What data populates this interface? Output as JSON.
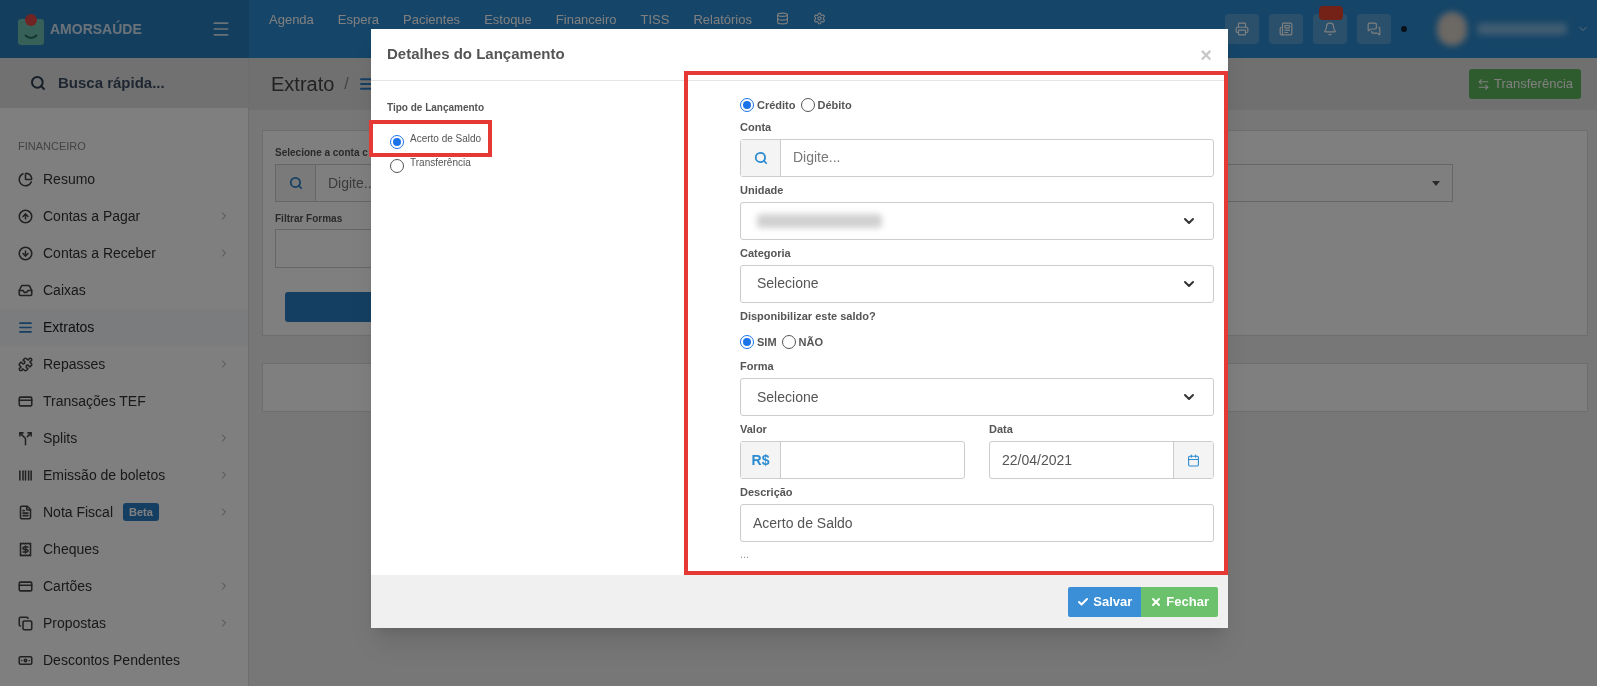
{
  "header": {
    "logo": "AMORSAÚDE",
    "nav": [
      "Agenda",
      "Espera",
      "Pacientes",
      "Estoque",
      "Financeiro",
      "TISS",
      "Relatórios"
    ]
  },
  "sidebar": {
    "search_placeholder": "Busca rápida...",
    "section": "FINANCEIRO",
    "items": [
      {
        "label": "Resumo",
        "expandable": false,
        "selected": false
      },
      {
        "label": "Contas a Pagar",
        "expandable": true,
        "selected": false
      },
      {
        "label": "Contas a Receber",
        "expandable": true,
        "selected": false
      },
      {
        "label": "Caixas",
        "expandable": false,
        "selected": false
      },
      {
        "label": "Extratos",
        "expandable": false,
        "selected": true
      },
      {
        "label": "Repasses",
        "expandable": true,
        "selected": false
      },
      {
        "label": "Transações TEF",
        "expandable": false,
        "selected": false
      },
      {
        "label": "Splits",
        "expandable": true,
        "selected": false
      },
      {
        "label": "Emissão de boletos",
        "expandable": true,
        "selected": false
      },
      {
        "label": "Nota Fiscal",
        "expandable": true,
        "selected": false,
        "badge": "Beta"
      },
      {
        "label": "Cheques",
        "expandable": false,
        "selected": false
      },
      {
        "label": "Cartões",
        "expandable": true,
        "selected": false
      },
      {
        "label": "Propostas",
        "expandable": true,
        "selected": false
      },
      {
        "label": "Descontos Pendentes",
        "expandable": false,
        "selected": false
      }
    ]
  },
  "page": {
    "title": "Extrato",
    "breadcrumb_separator": "/",
    "transfer_button": "Transferência",
    "account_label": "Selecione a conta c",
    "account_placeholder": "Digite..",
    "filter_label": "Filtrar Formas"
  },
  "modal": {
    "title": "Detalhes do Lançamento",
    "close": "×",
    "type_label": "Tipo de Lançamento",
    "types": [
      {
        "label": "Acerto de Saldo",
        "selected": true
      },
      {
        "label": "Transferência",
        "selected": false
      }
    ],
    "movement": [
      {
        "label": "Crédito",
        "selected": true
      },
      {
        "label": "Débito",
        "selected": false
      }
    ],
    "conta": {
      "label": "Conta",
      "placeholder": "Digite..."
    },
    "unidade": {
      "label": "Unidade"
    },
    "categoria": {
      "label": "Categoria",
      "value": "Selecione"
    },
    "disponibilizar": {
      "label": "Disponibilizar este saldo?",
      "options": [
        {
          "label": "SIM",
          "selected": true
        },
        {
          "label": "NÃO",
          "selected": false
        }
      ]
    },
    "forma": {
      "label": "Forma",
      "value": "Selecione"
    },
    "valor": {
      "label": "Valor",
      "prefix": "R$"
    },
    "data": {
      "label": "Data",
      "value": "22/04/2021"
    },
    "descricao": {
      "label": "Descrição",
      "value": "Acerto de Saldo"
    },
    "more": "...",
    "buttons": [
      {
        "label": "Salvar",
        "kind": "primary"
      },
      {
        "label": "Fechar",
        "kind": "close"
      }
    ]
  }
}
